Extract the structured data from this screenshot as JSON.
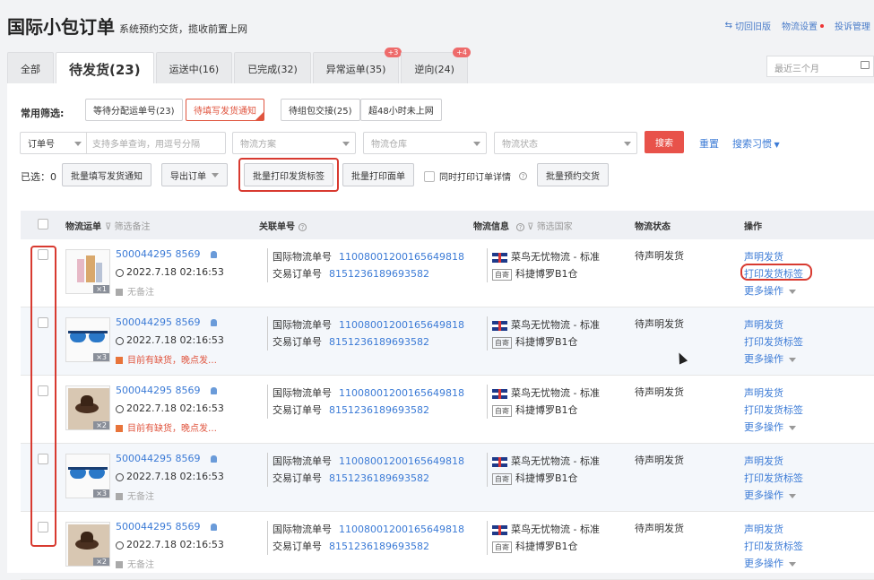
{
  "header": {
    "title": "国际小包订单",
    "subtitle": "系统预约交货，揽收前置上网",
    "links": [
      "切回旧版",
      "物流设置",
      "投诉管理"
    ]
  },
  "tabs": [
    {
      "label": "全部"
    },
    {
      "label": "待发货(23)",
      "active": true
    },
    {
      "label": "运送中(16)"
    },
    {
      "label": "已完成(32)"
    },
    {
      "label": "异常运单(35)",
      "badge": "+3"
    },
    {
      "label": "逆向(24)",
      "badge": "+4"
    }
  ],
  "date_placeholder": "最近三个月",
  "quick": {
    "label": "常用筛选:",
    "filters": [
      "等待分配运单号(23)",
      "待填写发货通知",
      "待组包交接(25)",
      "超48小时未上网"
    ]
  },
  "filters": {
    "order_type": "订单号",
    "order_placeholder": "支持多单查询，用逗号分隔",
    "scheme": "物流方案",
    "warehouse": "物流仓库",
    "status": "物流状态",
    "search": "搜索",
    "reset": "重置",
    "habit": "搜索习惯"
  },
  "actions": {
    "selected": "已选：0",
    "batch_fill": "批量填写发货通知",
    "export": "导出订单",
    "batch_print_label": "批量打印发货标签",
    "batch_print_face": "批量打印面单",
    "print_detail": "同时打印订单详情",
    "batch_reserve": "批量预约交货"
  },
  "table": {
    "headers": {
      "waybill": "物流运单",
      "waybill_filter": "筛选备注",
      "related": "关联单号",
      "logistics": "物流信息",
      "country_filter": "筛选国家",
      "status": "物流状态",
      "ops": "操作"
    },
    "rows": [
      {
        "waybill": "500044295 8569",
        "time": "2022.7.18 02:16:53",
        "note": "无备注",
        "warn": false,
        "qty": "×1",
        "intl_label": "国际物流单号",
        "intl_no": "1100800120016564981​8",
        "trade_label": "交易订单号",
        "trade_no": "8151236189693582",
        "carrier": "菜鸟无忧物流 - 标准",
        "self_tag": "自寄",
        "warehouse": "科捷博罗B1仓",
        "status": "待声明发货",
        "op1": "声明发货",
        "op2": "打印发货标签",
        "op3": "更多操作"
      },
      {
        "waybill": "500044295 8569",
        "time": "2022.7.18 02:16:53",
        "note": "目前有缺货，晚点发…",
        "warn": true,
        "qty": "×3",
        "intl_label": "国际物流单号",
        "intl_no": "1100800120016564981​8",
        "trade_label": "交易订单号",
        "trade_no": "8151236189693582",
        "carrier": "菜鸟无忧物流 - 标准",
        "self_tag": "自寄",
        "warehouse": "科捷博罗B1仓",
        "status": "待声明发货",
        "op1": "声明发货",
        "op2": "打印发货标签",
        "op3": "更多操作"
      },
      {
        "waybill": "500044295 8569",
        "time": "2022.7.18 02:16:53",
        "note": "目前有缺货，晚点发…",
        "warn": true,
        "qty": "×2",
        "intl_label": "国际物流单号",
        "intl_no": "1100800120016564981​8",
        "trade_label": "交易订单号",
        "trade_no": "8151236189693582",
        "carrier": "菜鸟无忧物流 - 标准",
        "self_tag": "自寄",
        "warehouse": "科捷博罗B1仓",
        "status": "待声明发货",
        "op1": "声明发货",
        "op2": "打印发货标签",
        "op3": "更多操作"
      },
      {
        "waybill": "500044295 8569",
        "time": "2022.7.18 02:16:53",
        "note": "无备注",
        "warn": false,
        "qty": "×3",
        "intl_label": "国际物流单号",
        "intl_no": "1100800120016564981​8",
        "trade_label": "交易订单号",
        "trade_no": "8151236189693582",
        "carrier": "菜鸟无忧物流 - 标准",
        "self_tag": "自寄",
        "warehouse": "科捷博罗B1仓",
        "status": "待声明发货",
        "op1": "声明发货",
        "op2": "打印发货标签",
        "op3": "更多操作"
      },
      {
        "waybill": "500044295 8569",
        "time": "2022.7.18 02:16:53",
        "note": "无备注",
        "warn": false,
        "qty": "×2",
        "intl_label": "国际物流单号",
        "intl_no": "1100800120016564981​8",
        "trade_label": "交易订单号",
        "trade_no": "8151236189693582",
        "carrier": "菜鸟无忧物流 - 标准",
        "self_tag": "自寄",
        "warehouse": "科捷博罗B1仓",
        "status": "待声明发货",
        "op1": "声明发货",
        "op2": "打印发货标签",
        "op3": "更多操作"
      }
    ]
  }
}
